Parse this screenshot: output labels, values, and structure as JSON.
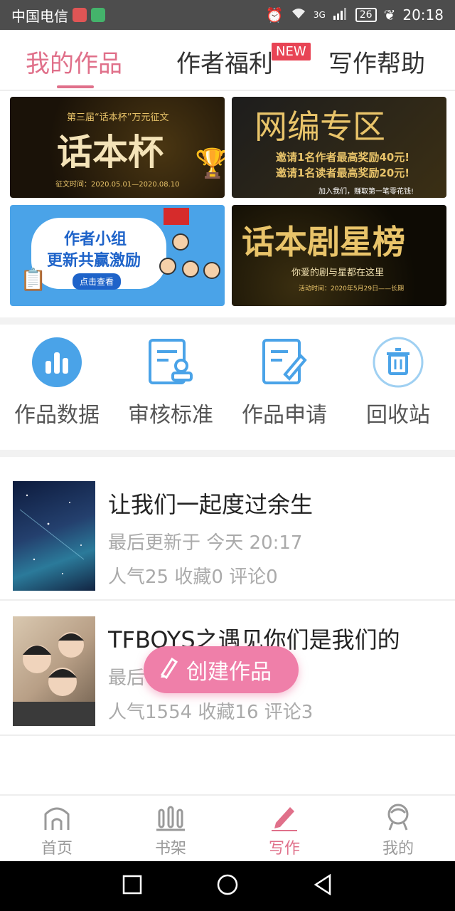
{
  "statusbar": {
    "carrier": "中国电信",
    "signal_label": "3G",
    "battery": "26",
    "time": "20:18"
  },
  "tabs": {
    "my_works": "我的作品",
    "author_welfare": "作者福利",
    "new_badge": "NEW",
    "writing_help": "写作帮助"
  },
  "banners": [
    {
      "title": "话本杯",
      "subtitle": "第三届“话本杯”万元征文",
      "detail": "征文时间：2020.05.01—2020.08.10"
    },
    {
      "title": "网编专区",
      "line1": "邀请1名作者最高奖励40元!",
      "line2": "邀请1名读者最高奖励20元!",
      "footer": "加入我们，赚取第一笔零花钱!"
    },
    {
      "line1": "作者小组",
      "line2": "更新共赢激励",
      "button": "点击查看"
    },
    {
      "title": "话本剧星榜",
      "subtitle": "你爱的剧与星都在这里",
      "detail": "活动时间：2020年5月29日——长期"
    }
  ],
  "tools": [
    {
      "label": "作品数据",
      "icon": "bar-chart-icon"
    },
    {
      "label": "审核标准",
      "icon": "review-standard-icon"
    },
    {
      "label": "作品申请",
      "icon": "edit-document-icon"
    },
    {
      "label": "回收站",
      "icon": "trash-icon"
    }
  ],
  "works": [
    {
      "title": "让我们一起度过余生",
      "updated": "最后更新于 今天 20:17",
      "stats": "人气25 收藏0 评论0"
    },
    {
      "title": "TFBOYS之遇见你们是我们的",
      "updated": "最后",
      "stats": "人气1554 收藏16 评论3"
    }
  ],
  "fab": {
    "label": "创建作品"
  },
  "bottomnav": [
    {
      "label": "首页",
      "icon": "home-icon"
    },
    {
      "label": "书架",
      "icon": "bookshelf-icon"
    },
    {
      "label": "写作",
      "icon": "pen-icon"
    },
    {
      "label": "我的",
      "icon": "profile-icon"
    }
  ],
  "colors": {
    "accent": "#e0708a",
    "fab": "#ef7fa9",
    "tool_icon": "#4aa3e8",
    "badge": "#e84455"
  }
}
